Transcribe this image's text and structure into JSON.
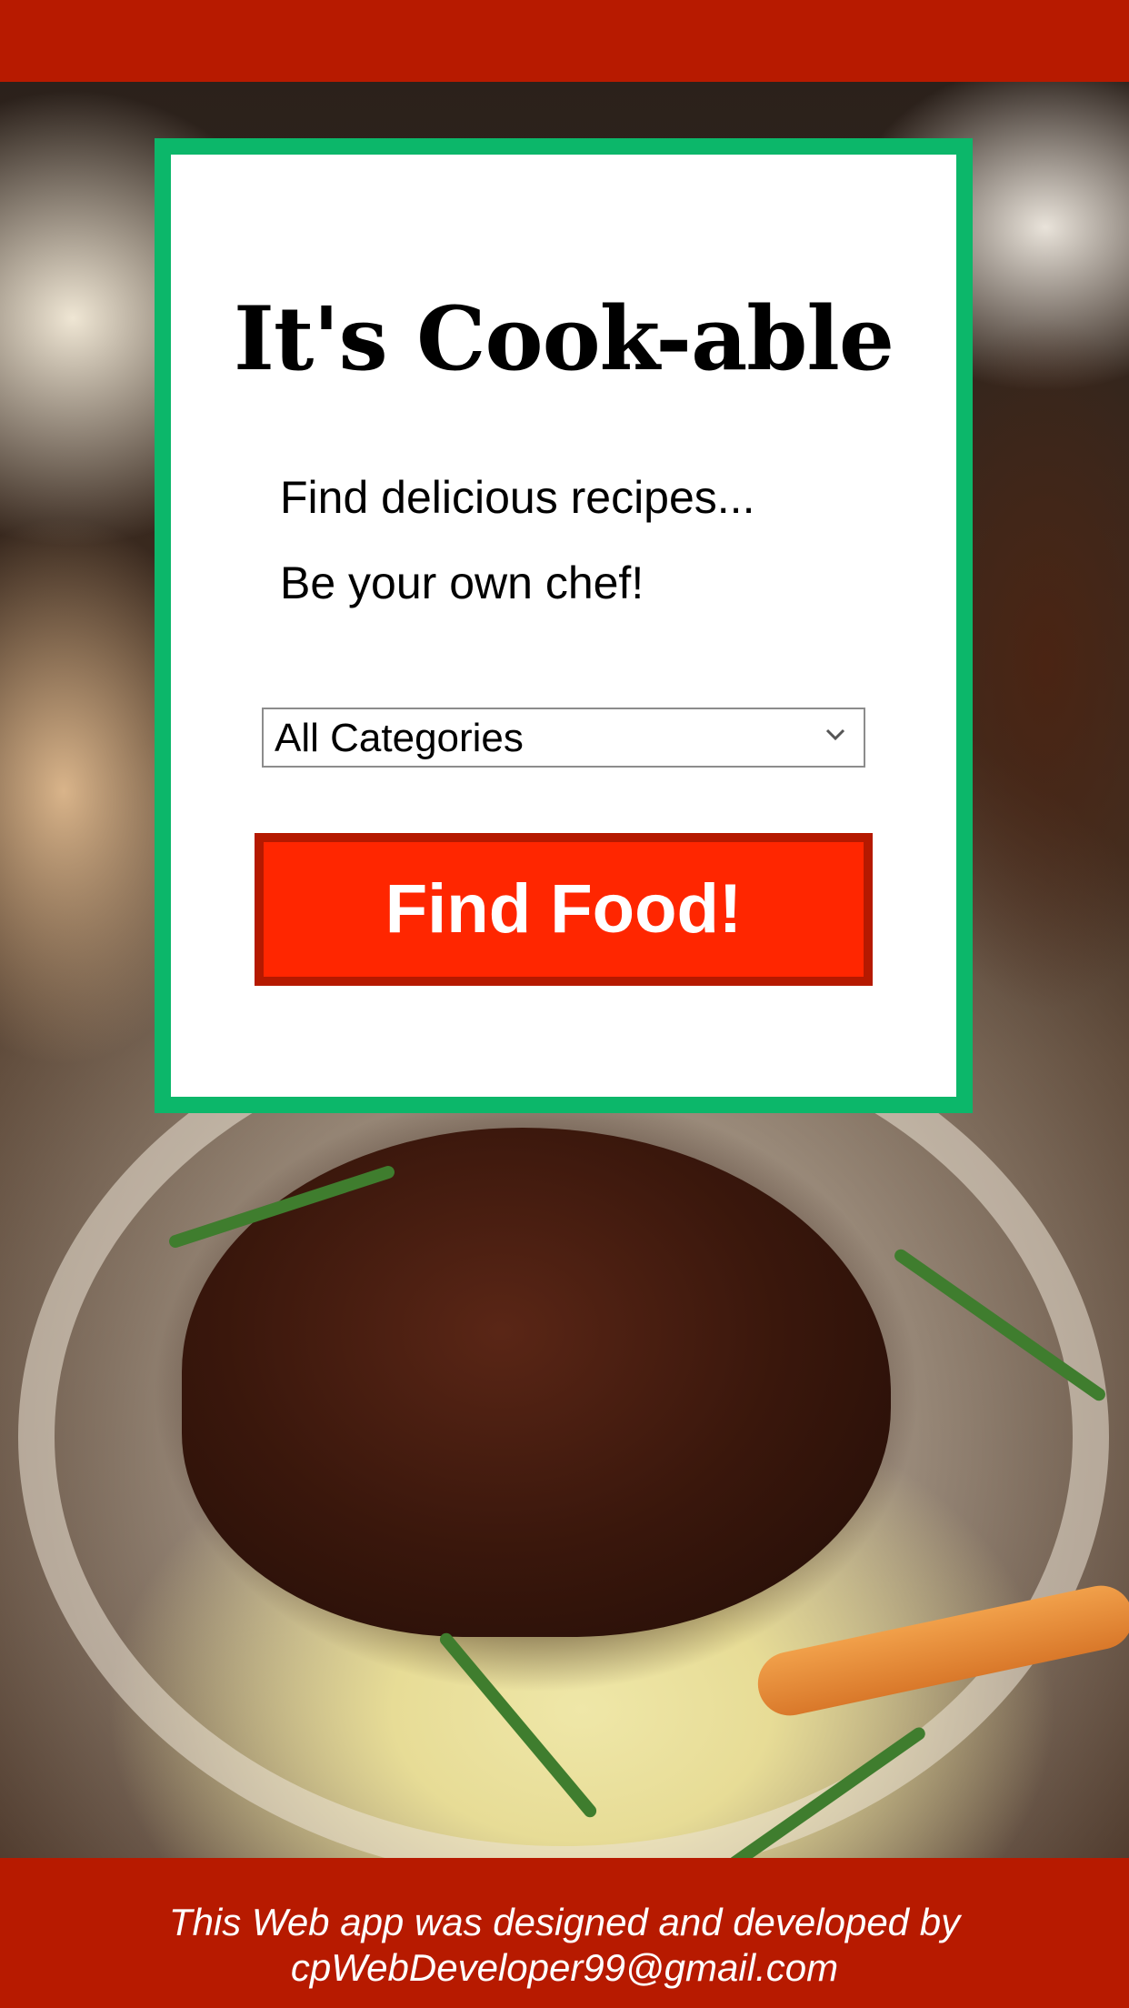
{
  "app": {
    "title": "It's Cook-able",
    "taglines": [
      "Find delicious recipes...",
      "Be your own chef!"
    ]
  },
  "category_select": {
    "selected": "All Categories",
    "icon": "chevron-down-icon"
  },
  "search_button": {
    "label": "Find Food!"
  },
  "footer": {
    "line1": "This Web app was designed and developed by",
    "line2": "cpWebDeveloper99@gmail.com"
  },
  "colors": {
    "top_bar": "#b71a00",
    "card_border": "#0cb76a",
    "button_bg": "#ff2600",
    "button_border": "#b51900",
    "footer_bg": "#b71a00"
  }
}
